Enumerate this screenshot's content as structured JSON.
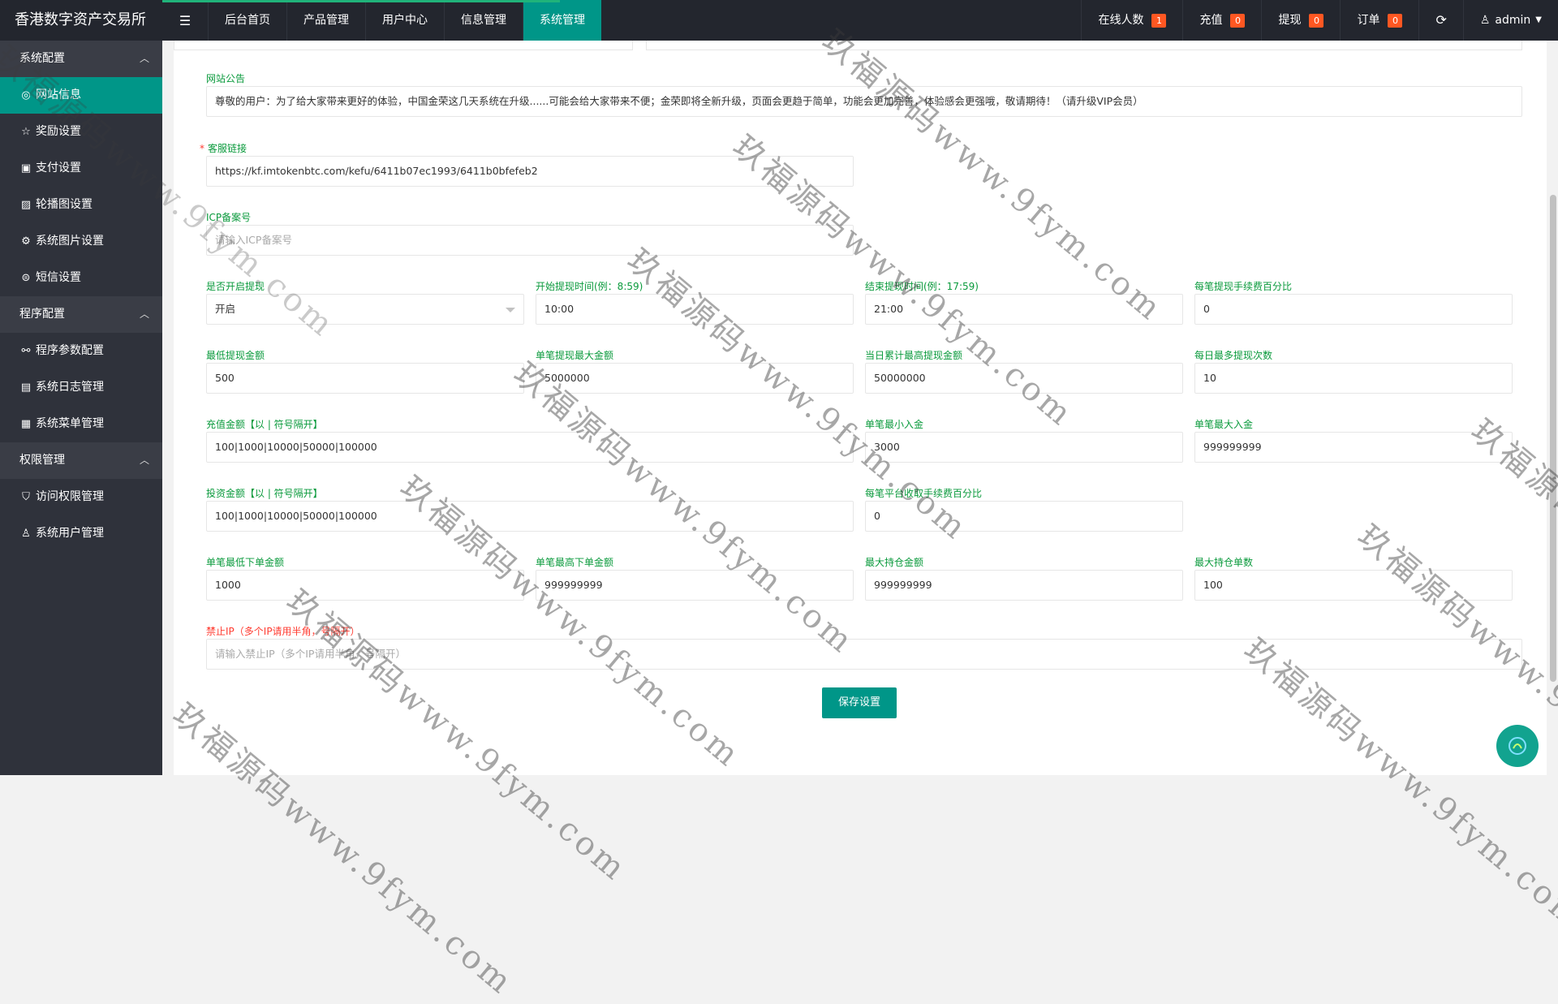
{
  "app": {
    "title": "香港数字资产交易所"
  },
  "topnav": {
    "menu_icon": "menu-icon",
    "items": [
      {
        "label": "后台首页"
      },
      {
        "label": "产品管理"
      },
      {
        "label": "用户中心"
      },
      {
        "label": "信息管理"
      },
      {
        "label": "系统管理",
        "active": true
      }
    ]
  },
  "topright": {
    "online": {
      "label": "在线人数",
      "count": "1"
    },
    "recharge": {
      "label": "充值",
      "count": "0"
    },
    "withdraw": {
      "label": "提现",
      "count": "0"
    },
    "orders": {
      "label": "订单",
      "count": "0"
    },
    "refresh_icon": "refresh-icon",
    "user": "admin"
  },
  "sidebar": {
    "groups": [
      {
        "label": "系统配置",
        "items": [
          {
            "label": "网站信息",
            "icon": "globe-icon",
            "active": true
          },
          {
            "label": "奖励设置",
            "icon": "star-icon"
          },
          {
            "label": "支付设置",
            "icon": "money-icon"
          },
          {
            "label": "轮播图设置",
            "icon": "image-icon"
          },
          {
            "label": "系统图片设置",
            "icon": "gear-icon"
          },
          {
            "label": "短信设置",
            "icon": "message-icon"
          }
        ]
      },
      {
        "label": "程序配置",
        "items": [
          {
            "label": "程序参数配置",
            "icon": "link-icon"
          },
          {
            "label": "系统日志管理",
            "icon": "log-icon"
          },
          {
            "label": "系统菜单管理",
            "icon": "menu-table-icon"
          }
        ]
      },
      {
        "label": "权限管理",
        "items": [
          {
            "label": "访问权限管理",
            "icon": "shield-icon"
          },
          {
            "label": "系统用户管理",
            "icon": "user-icon"
          }
        ]
      }
    ]
  },
  "form": {
    "notice": {
      "label": "网站公告",
      "value": "尊敬的用户：为了给大家带来更好的体验，中国金荣这几天系统在升级......可能会给大家带来不便；金荣即将全新升级，页面会更趋于简单，功能会更加完善，体验感会更强哦，敬请期待！（请升级VIP会员）"
    },
    "service": {
      "label": "客服链接",
      "value": "https://kf.imtokenbtc.com/kefu/6411b07ec1993/6411b0bfefeb2"
    },
    "icp": {
      "label": "ICP备案号",
      "placeholder": "请输入ICP备案号"
    },
    "withdraw_enabled": {
      "label": "是否开启提现",
      "value": "开启"
    },
    "withdraw_start": {
      "label": "开始提现时间(例：8:59)",
      "value": "10:00"
    },
    "withdraw_end": {
      "label": "结束提现时间(例：17:59)",
      "value": "21:00"
    },
    "withdraw_fee": {
      "label": "每笔提现手续费百分比",
      "value": "0"
    },
    "withdraw_min": {
      "label": "最低提现金额",
      "value": "500"
    },
    "withdraw_max": {
      "label": "单笔提现最大金额",
      "value": "5000000"
    },
    "withdraw_day_max": {
      "label": "当日累计最高提现金额",
      "value": "50000000"
    },
    "withdraw_day_count": {
      "label": "每日最多提现次数",
      "value": "10"
    },
    "recharge_amounts": {
      "label": "充值金额【以 | 符号隔开】",
      "value": "100|1000|10000|50000|100000"
    },
    "deposit_min": {
      "label": "单笔最小入金",
      "value": "3000"
    },
    "deposit_max": {
      "label": "单笔最大入金",
      "value": "999999999"
    },
    "invest_amounts": {
      "label": "投资金额【以 | 符号隔开】",
      "value": "100|1000|10000|50000|100000"
    },
    "platform_fee": {
      "label": "每笔平台收取手续费百分比",
      "value": "0"
    },
    "order_min": {
      "label": "单笔最低下单金额",
      "value": "1000"
    },
    "order_max": {
      "label": "单笔最高下单金额",
      "value": "999999999"
    },
    "position_max": {
      "label": "最大持仓金额",
      "value": "999999999"
    },
    "position_count": {
      "label": "最大持仓单数",
      "value": "100"
    },
    "banned_ip": {
      "label": "禁止IP（多个IP请用半角，号隔开）",
      "placeholder": "请输入禁止IP（多个IP请用半角，号隔开）"
    },
    "save_label": "保存设置"
  },
  "watermark": {
    "text": "玖福源码www.9fym.com"
  },
  "colors": {
    "accent": "#009688",
    "label_green": "#0a9a3c",
    "badge": "#ff5722",
    "header": "#23262e",
    "sidebar": "#2f323b"
  }
}
